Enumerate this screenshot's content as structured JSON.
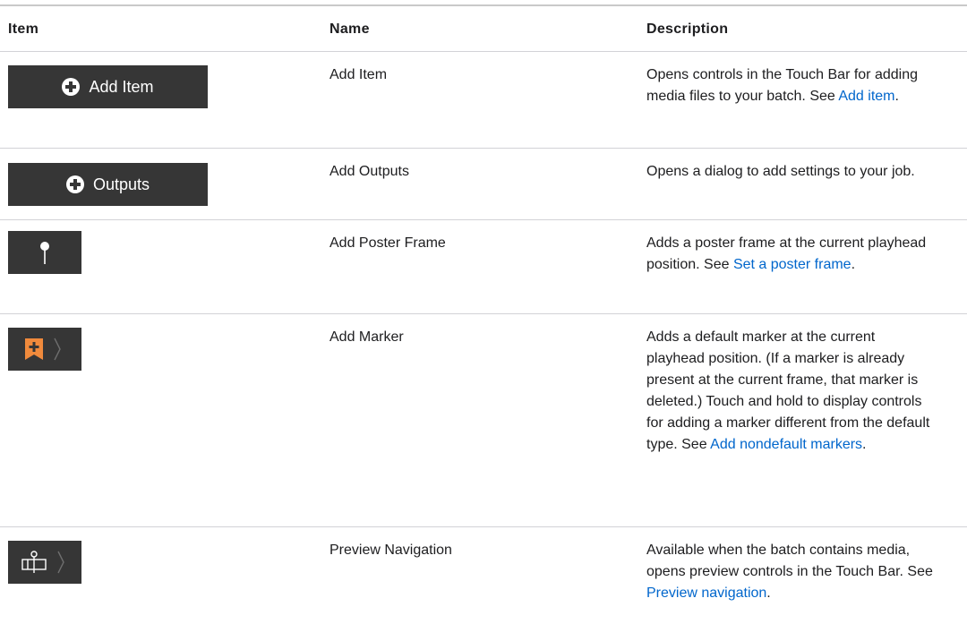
{
  "table": {
    "headers": {
      "item": "Item",
      "name": "Name",
      "description": "Description"
    },
    "rows": [
      {
        "button_label": "Add Item",
        "icon": "plus-circle-icon",
        "name": "Add Item",
        "desc_text": "Opens controls in the Touch Bar for adding media files to your batch. See ",
        "link": "Add item",
        "desc_end": "."
      },
      {
        "button_label": "Outputs",
        "icon": "plus-circle-icon",
        "name": "Add Outputs",
        "desc_text": "Opens a dialog to add settings to your job.",
        "link": "",
        "desc_end": ""
      },
      {
        "icon": "poster-frame-pin-icon",
        "name": "Add Poster Frame",
        "desc_text": "Adds a poster frame at the current playhead position. See ",
        "link": "Set a poster frame",
        "desc_end": "."
      },
      {
        "icon": "add-marker-icon",
        "name": "Add Marker",
        "desc_text": "Adds a default marker at the current playhead position. (If a marker is already present at the current frame, that marker is deleted.) Touch and hold to display controls for adding a marker different from the default type. See ",
        "link": "Add nondefault markers",
        "desc_end": "."
      },
      {
        "icon": "preview-navigation-icon",
        "name": "Preview Navigation",
        "desc_text": "Available when the batch contains media, opens preview controls in the Touch Bar. See ",
        "link": "Preview navigation",
        "desc_end": "."
      }
    ]
  },
  "colors": {
    "touchbar_bg": "#363636",
    "marker_orange": "#f08a3c",
    "link": "#0066cc"
  }
}
